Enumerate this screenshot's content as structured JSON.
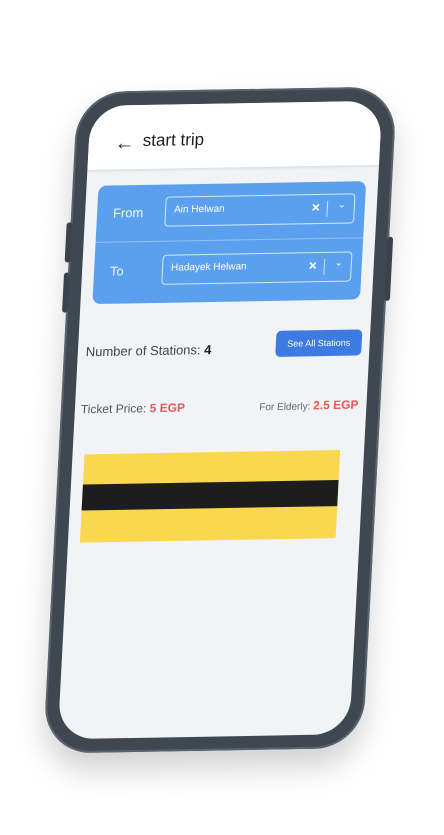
{
  "app_bar": {
    "back_icon": "arrow-left-icon",
    "title": "start trip"
  },
  "route": {
    "from_label": "From",
    "from_value": "Ain Helwan",
    "to_label": "To",
    "to_value": "Hadayek Helwan",
    "clear_icon": "close-icon",
    "dropdown_icon": "chevron-down-icon"
  },
  "stations": {
    "label": "Number of Stations:",
    "count": "4",
    "button": "See All Stations"
  },
  "price": {
    "label": "Ticket Price:",
    "value": "5 EGP",
    "elderly_label": "For Elderly:",
    "elderly_value": "2.5 EGP"
  },
  "colors": {
    "accent": "#5aa0ee",
    "button": "#3d7be3",
    "price": "#ef5656",
    "ticket_yellow": "#f9d850",
    "phone_body": "#3f4850"
  }
}
